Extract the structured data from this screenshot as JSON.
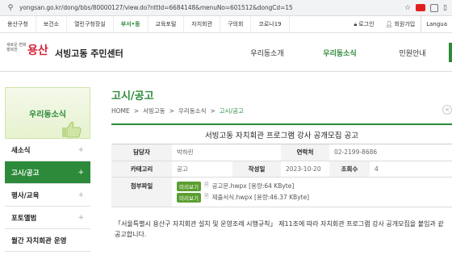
{
  "browser": {
    "url": "yongsan.go.kr/dong/bbs/80000127/view.do?nttId=6684148&menuNo=601512&dongCd=15"
  },
  "util_bar": {
    "tabs": [
      {
        "label": "용산구청"
      },
      {
        "label": "보건소"
      },
      {
        "label": "열린구청장실"
      },
      {
        "label": "부서•동"
      },
      {
        "label": "교육포털"
      },
      {
        "label": "자치회관"
      },
      {
        "label": "구의회"
      },
      {
        "label": "코로나19"
      }
    ],
    "login": "로그인",
    "signup": "회원가입",
    "language": "Langua"
  },
  "header": {
    "logo_slogan": "새로운 변화 행복한",
    "logo_name": "용산",
    "center_name": "서빙고동 주민센터",
    "gnb": [
      {
        "label": "우리동소개"
      },
      {
        "label": "우리동소식"
      },
      {
        "label": "민원안내"
      }
    ]
  },
  "sidebar": {
    "title": "우리동소식",
    "items": [
      {
        "label": "새소식"
      },
      {
        "label": "고시/공고"
      },
      {
        "label": "행사/교육"
      },
      {
        "label": "포토앨범"
      },
      {
        "label": "월간 자치회관 운영"
      }
    ]
  },
  "main": {
    "title": "고시/공고",
    "breadcrumb": [
      "HOME",
      "서빙고동",
      "우리동소식",
      "고시/공고"
    ],
    "post_title": "서빙고동 자치회관 프로그램 강사 공개모집 공고",
    "labels": {
      "author": "담당자",
      "phone": "연락처",
      "category": "카테고리",
      "date": "작성일",
      "views": "조회수",
      "attachments": "첨부파일"
    },
    "author": "박하린",
    "phone": "02-2199-8686",
    "category": "공고",
    "date": "2023-10-20",
    "views": "4",
    "preview_label": "미리보기",
    "files": [
      {
        "name": "공고문.hwpx [용량:64 KByte]"
      },
      {
        "name": "제출서식.hwpx [용량:46.37 KByte]"
      }
    ],
    "body_line1": "「서울특별시 용산구 자치회관 설치 및 운영조례 시행규칙」 제11조에 따라 자치회관 프로그램 강사 공개모집을 붙임과 같",
    "body_line2": "공고합니다."
  }
}
